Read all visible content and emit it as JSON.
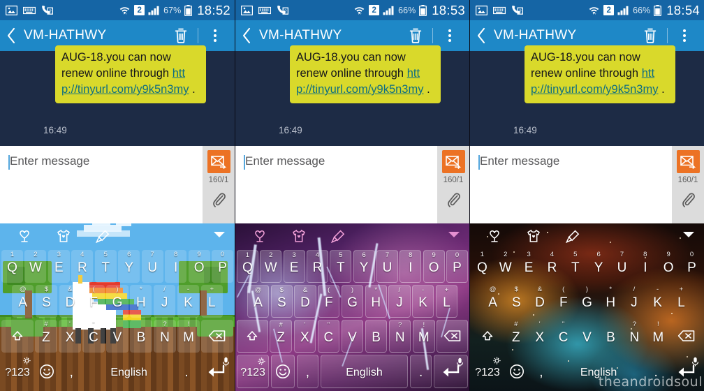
{
  "panels": [
    {
      "status": {
        "battery": "67%",
        "clock": "18:52",
        "sim": "2",
        "icons": [
          "image-icon",
          "keyboard-icon",
          "missed-call-sim2-icon",
          "wifi-icon",
          "signal-icon",
          "battery-icon"
        ]
      },
      "appbar": {
        "back": "back-icon",
        "title": "VM-HATHWY",
        "delete": "trash-icon",
        "more": "overflow-icon"
      },
      "message": {
        "text_before": "AUG-18.you can now renew online through ",
        "link": "http://tinyurl.com/y9k5n3my",
        "text_after": " .",
        "time": "16:49"
      },
      "compose": {
        "placeholder": "Enter message",
        "value": "",
        "counter": "160/1",
        "send": "send-sms-icon",
        "attach": "paperclip-icon"
      },
      "keyboard": {
        "theme": "unicorn-minecraft",
        "language": "English",
        "numeric": "?123",
        "toolbar": [
          "sticker-icon",
          "tshirt-theme-icon",
          "crayon-icon",
          "collapse-caret-icon"
        ]
      }
    },
    {
      "status": {
        "battery": "66%",
        "clock": "18:53",
        "sim": "2",
        "icons": [
          "image-icon",
          "keyboard-icon",
          "missed-call-sim2-icon",
          "wifi-icon",
          "signal-icon",
          "battery-icon"
        ]
      },
      "appbar": {
        "back": "back-icon",
        "title": "VM-HATHWY",
        "delete": "trash-icon",
        "more": "overflow-icon"
      },
      "message": {
        "text_before": "AUG-18.you can now renew online through ",
        "link": "http://tinyurl.com/y9k5n3my",
        "text_after": " .",
        "time": "16:49"
      },
      "compose": {
        "placeholder": "Enter message",
        "value": "",
        "counter": "160/1",
        "send": "send-sms-icon",
        "attach": "paperclip-icon"
      },
      "keyboard": {
        "theme": "purple-lightning",
        "language": "English",
        "numeric": "?123",
        "toolbar": [
          "sticker-icon",
          "tshirt-theme-icon",
          "crayon-icon",
          "collapse-caret-icon"
        ]
      }
    },
    {
      "status": {
        "battery": "66%",
        "clock": "18:54",
        "sim": "2",
        "icons": [
          "image-icon",
          "keyboard-icon",
          "missed-call-sim2-icon",
          "wifi-icon",
          "signal-icon",
          "battery-icon"
        ]
      },
      "appbar": {
        "back": "back-icon",
        "title": "VM-HATHWY",
        "delete": "trash-icon",
        "more": "overflow-icon"
      },
      "message": {
        "text_before": "AUG-18.you can now renew online through ",
        "link": "http://tinyurl.com/y9k5n3my",
        "text_after": " .",
        "time": "16:49"
      },
      "compose": {
        "placeholder": "Enter message",
        "value": "",
        "counter": "160/1",
        "send": "send-sms-icon",
        "attach": "paperclip-icon"
      },
      "keyboard": {
        "theme": "space-nebula",
        "language": "English",
        "numeric": "?123",
        "toolbar": [
          "sticker-icon",
          "tshirt-theme-icon",
          "crayon-icon",
          "collapse-caret-icon"
        ]
      }
    }
  ],
  "keyboard_layout": {
    "row1": [
      {
        "key": "Q",
        "sub": "1"
      },
      {
        "key": "W",
        "sub": "2"
      },
      {
        "key": "E",
        "sub": "3"
      },
      {
        "key": "R",
        "sub": "4"
      },
      {
        "key": "T",
        "sub": "5"
      },
      {
        "key": "Y",
        "sub": "6"
      },
      {
        "key": "U",
        "sub": "7"
      },
      {
        "key": "I",
        "sub": "8"
      },
      {
        "key": "O",
        "sub": "9"
      },
      {
        "key": "P",
        "sub": "0"
      }
    ],
    "row2": [
      {
        "key": "A",
        "sub": "@"
      },
      {
        "key": "S",
        "sub": "$"
      },
      {
        "key": "D",
        "sub": "&"
      },
      {
        "key": "F",
        "sub": "("
      },
      {
        "key": "G",
        "sub": ")"
      },
      {
        "key": "H",
        "sub": "*"
      },
      {
        "key": "J",
        "sub": "/"
      },
      {
        "key": "K",
        "sub": "-"
      },
      {
        "key": "L",
        "sub": "+"
      }
    ],
    "row3": [
      {
        "key": "shift-icon",
        "sub": "",
        "wide": true
      },
      {
        "key": "Z",
        "sub": "#"
      },
      {
        "key": "X",
        "sub": "'"
      },
      {
        "key": "C",
        "sub": "\""
      },
      {
        "key": "V",
        "sub": ""
      },
      {
        "key": "B",
        "sub": ""
      },
      {
        "key": "N",
        "sub": "?"
      },
      {
        "key": "M",
        "sub": "!"
      },
      {
        "key": "backspace-icon",
        "sub": "",
        "wide": true
      }
    ],
    "row4": [
      {
        "key": "?123",
        "name": "symbols-key"
      },
      {
        "key": "emoji-icon",
        "name": "emoji-key"
      },
      {
        "key": ",",
        "name": "comma-key"
      },
      {
        "key": "English",
        "name": "space-key"
      },
      {
        "key": ".",
        "name": "period-key"
      },
      {
        "key": "enter-icon",
        "name": "enter-key"
      }
    ]
  },
  "colors": {
    "statusbar": "#1565a5",
    "appbar": "#1e88c7",
    "conversation_bg": "#1d2b45",
    "bubble": "#d9d92b",
    "link": "#0e6e82",
    "send_button": "#ec7224",
    "compose_side": "#dcdcdc"
  },
  "watermark": "theandroidsoul"
}
